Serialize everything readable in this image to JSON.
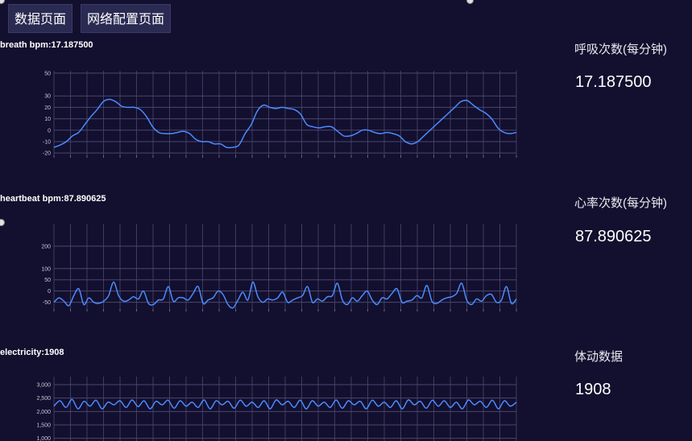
{
  "nav": {
    "data_page_label": "数据页面",
    "network_page_label": "网络配置页面"
  },
  "charts": [
    {
      "title": "breath bpm:17.187500",
      "side_label": "呼吸次数(每分钟)",
      "side_value": "17.187500",
      "line_color": "#4a8cff"
    },
    {
      "title": "heartbeat bpm:87.890625",
      "side_label": "心率次数(每分钟)",
      "side_value": "87.890625",
      "line_color": "#4a8cff"
    },
    {
      "title": "electricity:1908",
      "side_label": "体动数据",
      "side_value": "1908",
      "line_color": "#4a8cff"
    }
  ],
  "chart_data": [
    {
      "type": "line",
      "title": "breath bpm:17.187500",
      "ylim": [
        -22,
        52
      ],
      "yticks": [
        50,
        30,
        20,
        10,
        0,
        -10,
        -20
      ],
      "ytick_labels": [
        "50",
        "30",
        "20",
        "10",
        "0",
        "-10",
        "-20"
      ],
      "grid": true,
      "series": [
        {
          "values": [
            -15,
            -13,
            -10,
            -5,
            -2,
            5,
            12,
            18,
            25,
            27,
            25,
            21,
            20,
            20,
            18,
            12,
            3,
            -2,
            -3,
            -3,
            -2,
            -1,
            -3,
            -8,
            -10,
            -10,
            -12,
            -12,
            -15,
            -15,
            -13,
            -3,
            5,
            17,
            22,
            20,
            19,
            20,
            19,
            18,
            14,
            5,
            3,
            2,
            3,
            3,
            -1,
            -5,
            -5,
            -3,
            0,
            0,
            -2,
            -3,
            -2,
            -3,
            -5,
            -10,
            -12,
            -10,
            -5,
            0,
            5,
            10,
            15,
            20,
            25,
            26,
            22,
            18,
            15,
            10,
            2,
            -2,
            -3,
            -2
          ]
        }
      ]
    },
    {
      "type": "line",
      "title": "heartbeat bpm:87.890625",
      "ylim": [
        -80,
        300
      ],
      "yticks": [
        200,
        100,
        50,
        0,
        -50
      ],
      "ytick_labels": [
        "200",
        "100",
        "50",
        "0",
        "-50"
      ],
      "grid": true,
      "series": [
        {
          "values": [
            -50,
            -30,
            -45,
            -65,
            -20,
            10,
            -60,
            -30,
            -50,
            -55,
            -45,
            -20,
            40,
            -20,
            -45,
            -40,
            -25,
            -35,
            0,
            -55,
            -60,
            -40,
            -35,
            20,
            -45,
            -30,
            -30,
            -40,
            -10,
            20,
            -55,
            -40,
            -30,
            0,
            -15,
            -60,
            -75,
            -40,
            -5,
            -40,
            40,
            -25,
            -50,
            -35,
            -40,
            -30,
            -5,
            -50,
            -40,
            -30,
            -20,
            20,
            -50,
            -35,
            -45,
            -25,
            -20,
            35,
            -40,
            -60,
            -30,
            -45,
            -20,
            0,
            -40,
            -60,
            -30,
            -35,
            -10,
            10,
            -50,
            -45,
            -40,
            -20,
            -30,
            25,
            -45,
            -55,
            -40,
            -30,
            -25,
            -10,
            35,
            -40,
            -60,
            -35,
            -45,
            -20,
            -15,
            -50,
            -40,
            20,
            -55,
            -35
          ]
        }
      ]
    },
    {
      "type": "line",
      "title": "electricity:1908",
      "ylim": [
        900,
        3300
      ],
      "yticks": [
        3000,
        2500,
        2000,
        1500,
        1000
      ],
      "ytick_labels": [
        "3,000",
        "2,500",
        "2,000",
        "1,500",
        "1,000"
      ],
      "grid": true,
      "series": [
        {
          "values": [
            2200,
            2400,
            2150,
            2450,
            2100,
            2380,
            2200,
            2420,
            2100,
            2350,
            2250,
            2400,
            2150,
            2430,
            2180,
            2400,
            2100,
            2380,
            2250,
            2420,
            2120,
            2400,
            2200,
            2350,
            2150,
            2430,
            2100,
            2400,
            2250,
            2380,
            2120,
            2420,
            2200,
            2350,
            2150,
            2400,
            2100,
            2430,
            2250,
            2380,
            2150,
            2420,
            2100,
            2400,
            2200,
            2350,
            2150,
            2430,
            2120,
            2400,
            2250,
            2380,
            2100,
            2420,
            2200,
            2350,
            2150,
            2400,
            2100,
            2430,
            2250,
            2380,
            2120,
            2420,
            2200,
            2400,
            2150,
            2350,
            2100,
            2430,
            2250,
            2380,
            2150,
            2420,
            2100,
            2400,
            2200,
            2350
          ]
        }
      ]
    }
  ]
}
